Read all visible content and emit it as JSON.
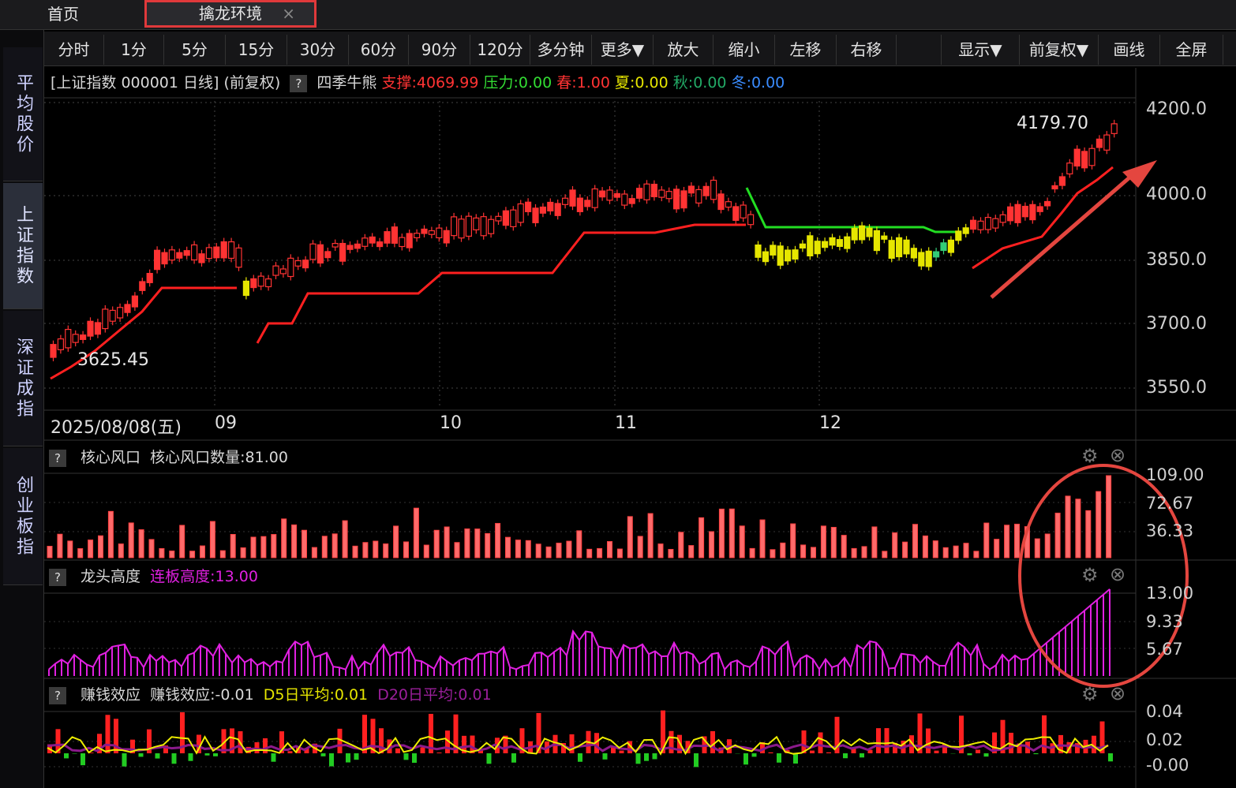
{
  "tabs": {
    "home": "首页",
    "active": "擒龙环境",
    "close": "×"
  },
  "sidebar": [
    {
      "label": "平均股价"
    },
    {
      "label": "上证指数"
    },
    {
      "label": "深证成指"
    },
    {
      "label": "创业板指"
    }
  ],
  "toolbar": [
    "分时",
    "1分",
    "5分",
    "15分",
    "30分",
    "60分",
    "90分",
    "120分",
    "多分钟",
    "更多▼",
    "放大",
    "缩小",
    "左移",
    "右移",
    "显示▼",
    "前复权▼",
    "画线",
    "全屏"
  ],
  "info": {
    "title": "[上证指数 000001 日线]",
    "fq": "(前复权)",
    "help": "?",
    "indicator": "四季牛熊",
    "support": "支撑:4069.99",
    "pressure": "压力:0.00",
    "spring": "春:1.00",
    "summer": "夏:0.00",
    "autumn": "秋:0.00",
    "winter": "冬:0.00"
  },
  "colors": {
    "support": "#ff3333",
    "pressure": "#33dd33",
    "spring": "#ff3333",
    "summer": "#e6e600",
    "autumn": "#22aa66",
    "winter": "#3a8cff",
    "magenta": "#e020e0"
  },
  "price_axis": [
    "4200.0",
    "4000.0",
    "3850.0",
    "3700.0",
    "3550.0"
  ],
  "annotations": {
    "high": "4179.70",
    "low": "3625.45"
  },
  "date_axis": {
    "start": "2025/08/08(五)",
    "m1": "09",
    "m2": "10",
    "m3": "11",
    "m4": "12"
  },
  "panel1": {
    "name": "核心风口",
    "value": "核心风口数量:81.00",
    "axis": [
      "109.00",
      "72.67",
      "36.33"
    ]
  },
  "panel2": {
    "name": "龙头高度",
    "value": "连板高度:13.00",
    "axis": [
      "13.00",
      "9.33",
      "5.67"
    ]
  },
  "panel3": {
    "name": "赚钱效应",
    "value": "赚钱效应:-0.01",
    "d5": "D5日平均:0.01",
    "d20": "D20日平均:0.01",
    "axis": [
      "0.04",
      "0.02",
      "-0.00"
    ]
  }
}
